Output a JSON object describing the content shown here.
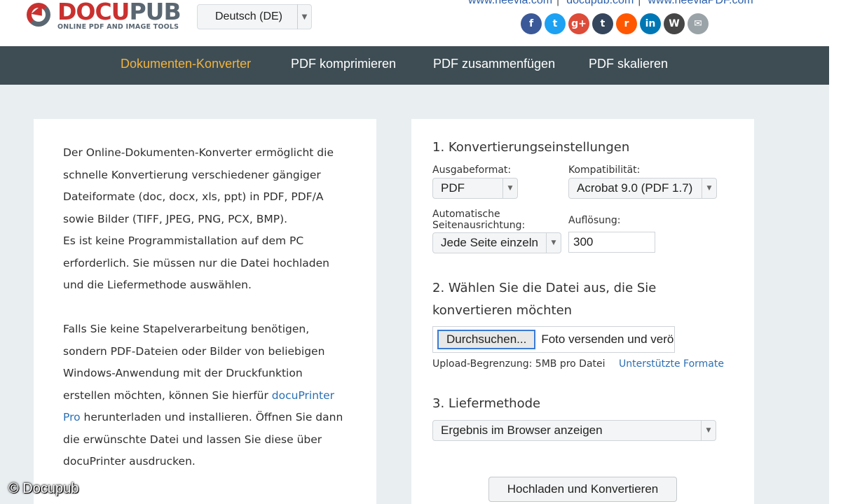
{
  "logo": {
    "docu": "DOCU",
    "pub": "PUB",
    "tagline": "ONLINE PDF AND IMAGE TOOLS"
  },
  "language": {
    "selected": "Deutsch (DE)"
  },
  "top_links": [
    "www.neevia.com",
    "docupub.com",
    "www.neeviaPDF.com"
  ],
  "social_icons": [
    {
      "name": "facebook-icon",
      "glyph": "f",
      "color": "#3b5998"
    },
    {
      "name": "twitter-icon",
      "glyph": "t",
      "color": "#1da1f2"
    },
    {
      "name": "google-plus-icon",
      "glyph": "g+",
      "color": "#dd4b39"
    },
    {
      "name": "tumblr-icon",
      "glyph": "t",
      "color": "#35465c"
    },
    {
      "name": "reddit-icon",
      "glyph": "r",
      "color": "#ff5700"
    },
    {
      "name": "linkedin-icon",
      "glyph": "in",
      "color": "#0077b5"
    },
    {
      "name": "wordpress-icon",
      "glyph": "W",
      "color": "#464646"
    },
    {
      "name": "email-icon",
      "glyph": "✉",
      "color": "#9aa3a8"
    }
  ],
  "nav": {
    "items": [
      "Dokumenten-Konverter",
      "PDF komprimieren",
      "PDF zusammenfügen",
      "PDF skalieren"
    ],
    "active_color": "#f2b33d"
  },
  "intro": {
    "p1": "Der Online-Dokumenten-Konverter ermöglicht die schnelle Konvertierung verschiedener gängiger Dateiformate (doc, docx, xls, ppt) in PDF, PDF/A sowie Bilder (TIFF, JPEG, PNG, PCX, BMP).",
    "p1b": "Es ist keine Programmistallation auf dem PC erforderlich. Sie müssen nur die Datei hochladen und die Liefermethode auswählen.",
    "p2_pre": "Falls Sie keine Stapelverarbeitung benötigen, sondern PDF-Dateien oder Bilder von beliebigen Windows-Anwendung mit der Druckfunktion erstellen möchten, können Sie hierfür ",
    "p2_link": "docuPrinter Pro",
    "p2_post": " herunterladen und installieren. Öffnen Sie dann die erwünschte Datei und lassen Sie diese über docuPrinter ausdrucken."
  },
  "settings": {
    "heading": "1. Konvertierungseinstellungen",
    "output_format_label": "Ausgabeformat:",
    "output_format": "PDF",
    "compat_label": "Kompatibilität:",
    "compat": "Acrobat 9.0 (PDF 1.7)",
    "orientation_label_1": "Automatische",
    "orientation_label_2": "Seitenausrichtung:",
    "orientation": "Jede Seite einzeln",
    "resolution_label": "Auflösung:",
    "resolution": "300"
  },
  "file": {
    "heading_1": "2. Wählen Sie die Datei aus, die Sie",
    "heading_2": "konvertieren möchten",
    "browse_label": "Durchsuchen...",
    "file_name": "Foto versenden und verö",
    "upload_limit": "Upload-Begrenzung: 5MB pro Datei",
    "formats_link": "Unterstützte Formate"
  },
  "delivery": {
    "heading": "3. Liefermethode",
    "selected": "Ergebnis im Browser anzeigen"
  },
  "submit_label": "Hochladen und Konvertieren",
  "watermark": "© Docupub"
}
